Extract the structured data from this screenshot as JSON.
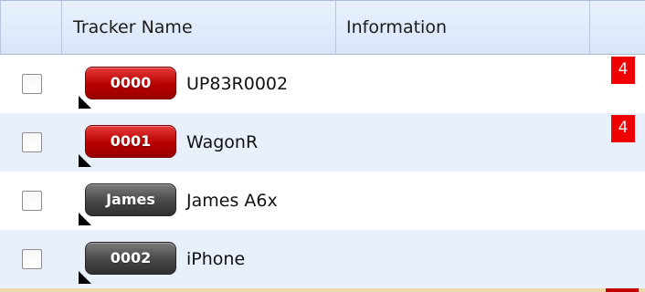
{
  "columns": {
    "tracker_name": "Tracker Name",
    "information": "Information"
  },
  "rows": [
    {
      "code": "0000",
      "name": "UP83R0002",
      "badge": "4",
      "pill_color": "red"
    },
    {
      "code": "0001",
      "name": "WagonR",
      "badge": "4",
      "pill_color": "red"
    },
    {
      "code": "James",
      "name": "James A6x",
      "badge": "",
      "pill_color": "grey"
    },
    {
      "code": "0002",
      "name": "iPhone",
      "badge": "",
      "pill_color": "grey"
    }
  ],
  "colors": {
    "header_bg": "#dfe9fa",
    "alt_row_bg": "#e8f0fc",
    "pill_red": "#c00000",
    "pill_grey": "#4a4a4a",
    "badge_red": "#ee0000"
  }
}
